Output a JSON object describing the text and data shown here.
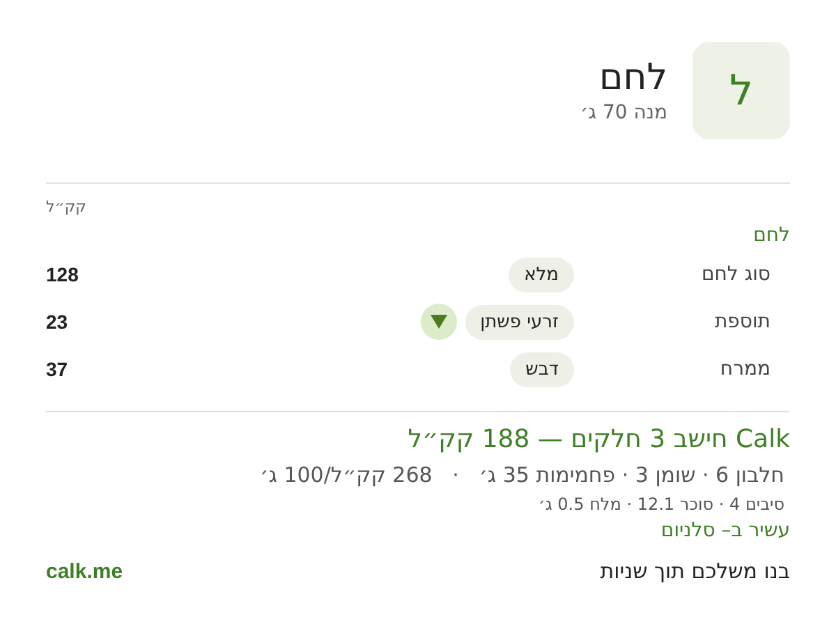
{
  "header": {
    "avatar_letter": "ל",
    "title": "לחם",
    "subtitle": "מנה 70 ג׳"
  },
  "unit_label": "קק״ל",
  "section": {
    "title": "לחם",
    "rows": [
      {
        "label": "סוג לחם",
        "value": "מלא",
        "menu": false,
        "kcal": "128"
      },
      {
        "label": "תוספת",
        "value": "זרעי פשתן",
        "menu": true,
        "kcal": "23"
      },
      {
        "label": "ממרח",
        "value": "דבש",
        "menu": false,
        "kcal": "37"
      }
    ]
  },
  "summary": {
    "title": "Calk חישב 3 חלקים — 188 קק״ל",
    "macros": "חלבון 6 · שומן 3 · פחמימות 35 ג׳   ·   268 קק״ל/100 ג׳",
    "details": "סיבים 4 · סוכר 12.1 · מלח 0.5 ג׳",
    "highlight": "עשיר ב– סלניום"
  },
  "footer": {
    "tagline": "בנו משלכם תוך שניות",
    "link": "calk.me"
  }
}
